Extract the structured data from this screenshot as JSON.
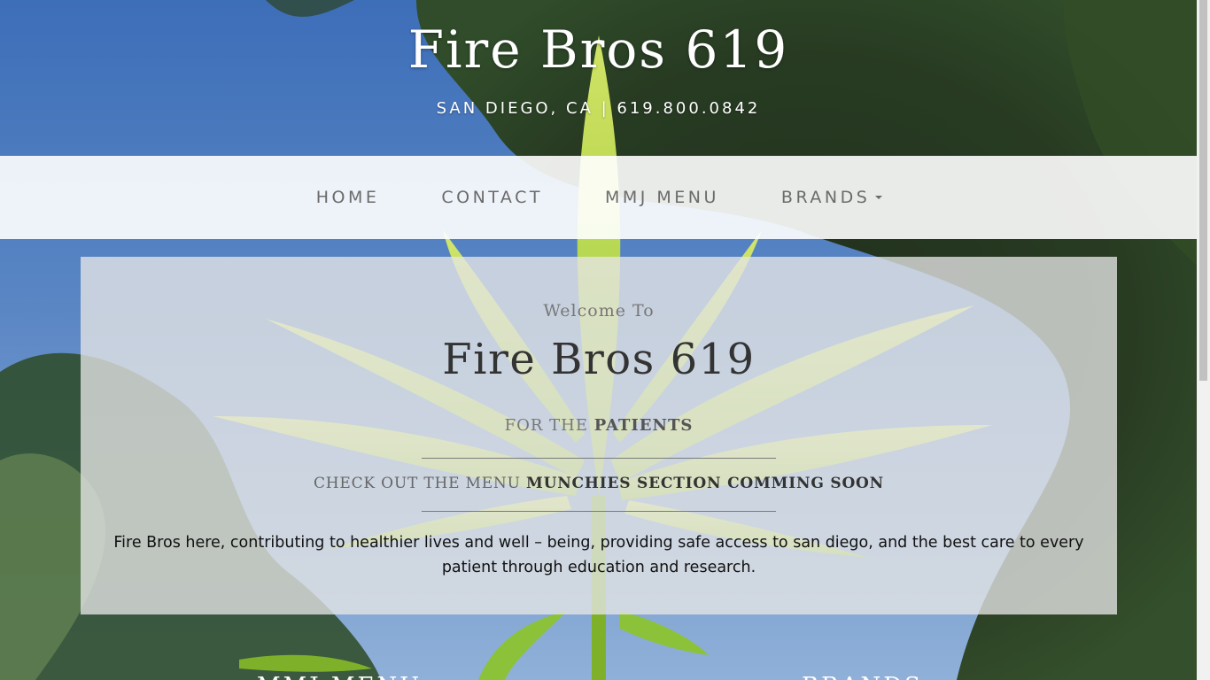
{
  "header": {
    "title": "Fire Bros 619",
    "tagline": "SAN DIEGO, CA | 619.800.0842"
  },
  "nav": {
    "items": [
      {
        "label": "HOME"
      },
      {
        "label": "CONTACT"
      },
      {
        "label": "MMJ MENU"
      },
      {
        "label": "BRANDS",
        "dropdown": true
      }
    ]
  },
  "panel": {
    "welcome": "Welcome To",
    "title": "Fire Bros 619",
    "for_prefix": "FOR THE",
    "for_strong": "PATIENTS",
    "menu_prefix": "CHECK OUT THE MENU",
    "menu_strong": "MUNCHIES SECTION COMMING SOON",
    "body": "Fire Bros here, contributing to healthier lives and well – being, providing safe access to san diego, and the best care to every patient through education and research."
  },
  "bottom": {
    "left_heading": "MMJ MENU",
    "right_heading": "BRANDS"
  },
  "colors": {
    "sky": "#3d6eb8",
    "leaf": "#c8e05a",
    "nav_text": "#6b6b6b",
    "panel_bg": "#e6e6e6"
  }
}
